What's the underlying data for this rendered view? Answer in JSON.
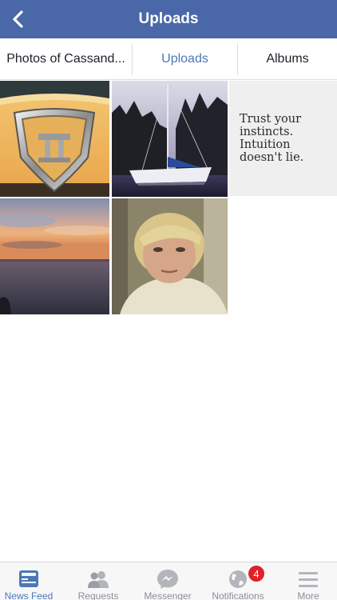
{
  "header": {
    "title": "Uploads",
    "back_icon": "chevron-left-icon"
  },
  "tabs": [
    {
      "label": "Photos of Cassand...",
      "active": false
    },
    {
      "label": "Uploads",
      "active": true
    },
    {
      "label": "Albums",
      "active": false
    }
  ],
  "quote_tile": {
    "text": "Trust your instincts. Intuition doesn't lie."
  },
  "tabbar": {
    "items": [
      {
        "label": "News Feed",
        "icon": "news-feed-icon",
        "active": true
      },
      {
        "label": "Requests",
        "icon": "requests-icon",
        "active": false
      },
      {
        "label": "Messenger",
        "icon": "messenger-icon",
        "active": false
      },
      {
        "label": "Notifications",
        "icon": "globe-icon",
        "active": false
      },
      {
        "label": "More",
        "icon": "menu-icon",
        "active": false
      }
    ],
    "notifications_badge": "4"
  },
  "colors": {
    "header": "#4a67a8",
    "accent": "#4c78b5",
    "badge": "#e0202a"
  }
}
